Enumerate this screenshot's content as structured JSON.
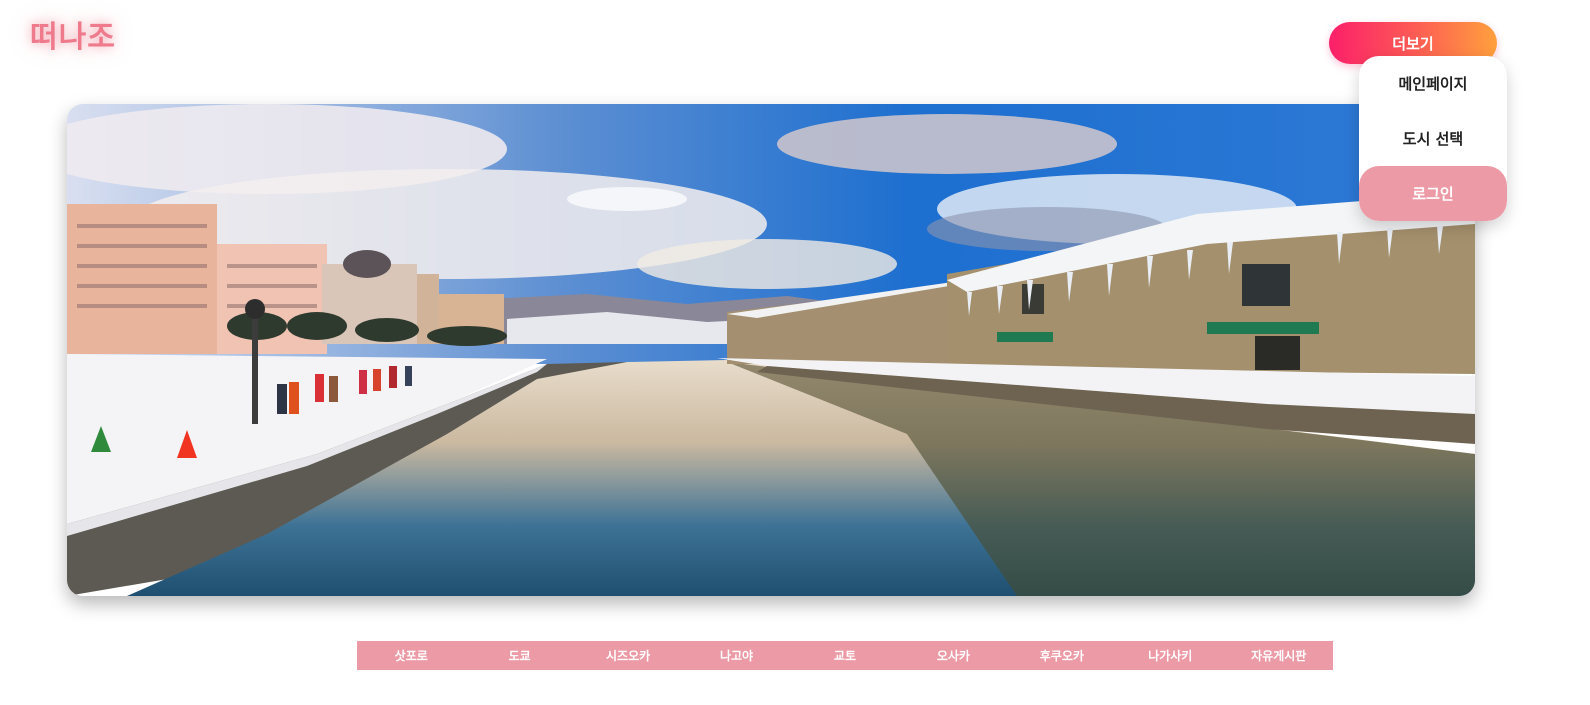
{
  "logo": {
    "text": "떠나조"
  },
  "header": {
    "more_button_label": "더보기"
  },
  "dropdown": {
    "items": [
      {
        "label": "메인페이지"
      },
      {
        "label": "도시 선택"
      },
      {
        "label": "로그인"
      }
    ]
  },
  "hero": {
    "image_icon": "winter-canal-photo"
  },
  "nav": {
    "items": [
      {
        "label": "삿포로"
      },
      {
        "label": "도쿄"
      },
      {
        "label": "시즈오카"
      },
      {
        "label": "나고야"
      },
      {
        "label": "교토"
      },
      {
        "label": "오사카"
      },
      {
        "label": "후쿠오카"
      },
      {
        "label": "나가사키"
      },
      {
        "label": "자유게시판"
      }
    ]
  },
  "colors": {
    "accent_pink": "#ec9aa6",
    "logo_pink": "#ee7a8c",
    "gradient_start": "#fb1f6a",
    "gradient_end": "#ffa03d"
  }
}
